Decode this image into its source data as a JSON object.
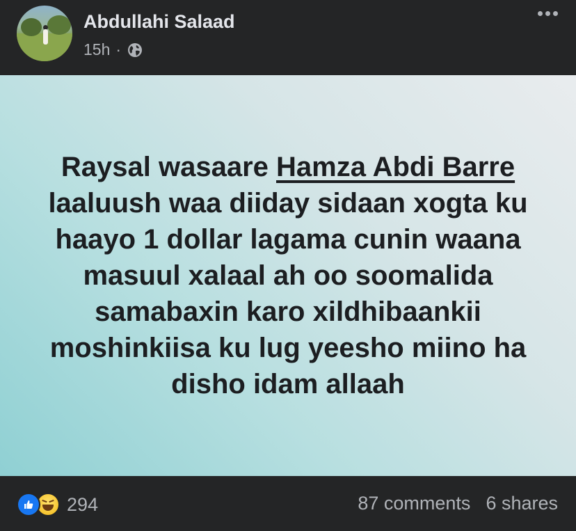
{
  "post": {
    "author": "Abdullahi Salaad",
    "time": "15h",
    "separator": "·",
    "privacy_icon": "globe-icon",
    "more_icon": "more-horizontal-icon",
    "text_before_mention": "Raysal wasaare ",
    "mention": "Hamza Abdi Barre",
    "text_after_mention": " laaluush waa diiday sidaan xogta ku haayo 1 dollar lagama cunin waana masuul xalaal ah oo soomalida samabaxin karo xildhibaankii moshinkiisa ku lug yeesho miino ha disho idam allaah"
  },
  "footer": {
    "reaction_icons": [
      "like-icon",
      "haha-icon"
    ],
    "reaction_count": "294",
    "comments": "87 comments",
    "shares": "6 shares"
  },
  "colors": {
    "background": "#242526",
    "like_blue": "#1877f2",
    "secondary_text": "#b0b3b8",
    "post_text": "#1c1e21"
  }
}
